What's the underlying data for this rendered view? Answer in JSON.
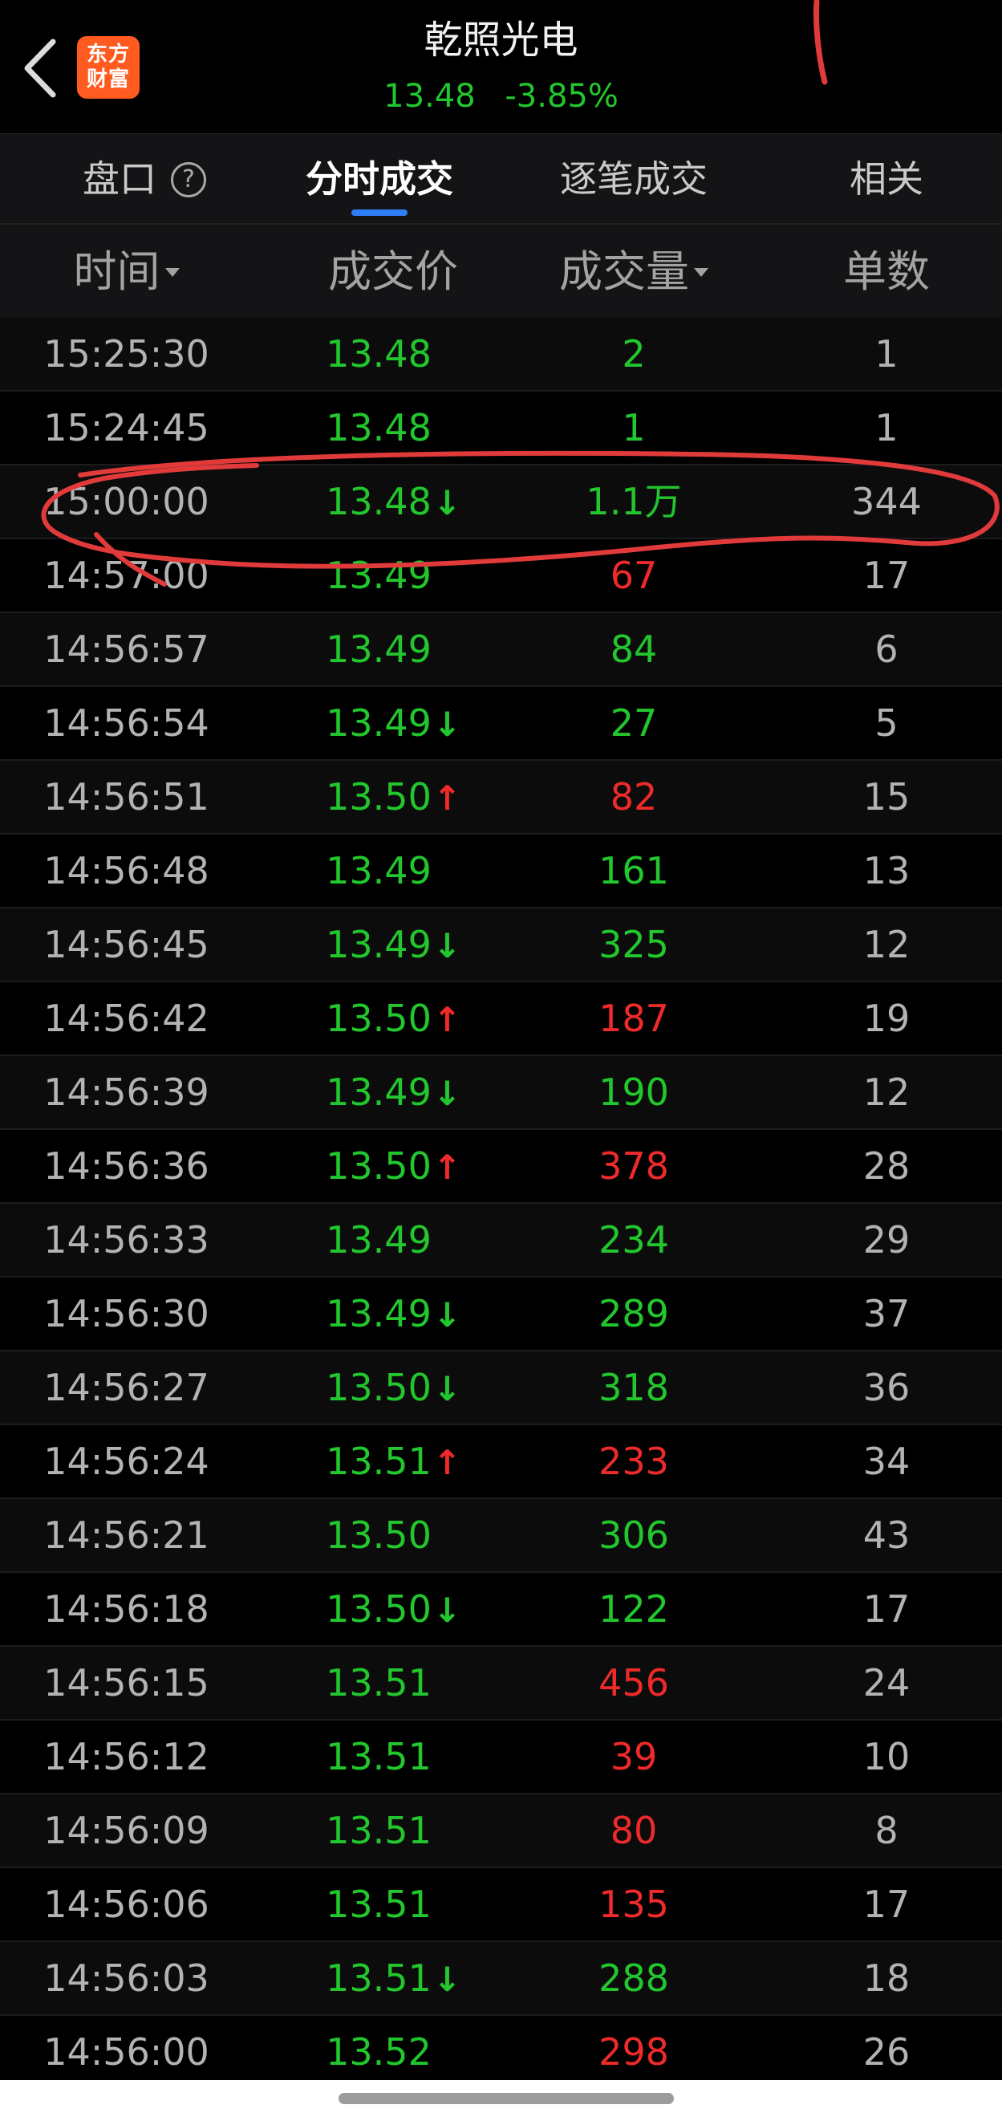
{
  "header": {
    "stock_name": "乾照光电",
    "price": "13.48",
    "change_pct": "-3.85%",
    "logo_line1": "东方",
    "logo_line2": "财富"
  },
  "tabs": [
    {
      "label": "盘口",
      "active": false
    },
    {
      "label": "分时成交",
      "active": true
    },
    {
      "label": "逐笔成交",
      "active": false
    },
    {
      "label": "相关",
      "active": false
    }
  ],
  "columns": {
    "time": "时间",
    "price": "成交价",
    "volume": "成交量",
    "count": "单数"
  },
  "colors": {
    "up": "#ee2a2a",
    "down": "#22c72e",
    "annotation": "#e03a3a"
  },
  "trades": [
    {
      "time": "15:25:30",
      "price": "13.48",
      "arrow": "",
      "volume": "2",
      "vol_color": "green",
      "count": "1"
    },
    {
      "time": "15:24:45",
      "price": "13.48",
      "arrow": "",
      "volume": "1",
      "vol_color": "green",
      "count": "1"
    },
    {
      "time": "15:00:00",
      "price": "13.48",
      "arrow": "down",
      "volume": "1.1万",
      "vol_color": "green",
      "count": "344"
    },
    {
      "time": "14:57:00",
      "price": "13.49",
      "arrow": "",
      "volume": "67",
      "vol_color": "red",
      "count": "17"
    },
    {
      "time": "14:56:57",
      "price": "13.49",
      "arrow": "",
      "volume": "84",
      "vol_color": "green",
      "count": "6"
    },
    {
      "time": "14:56:54",
      "price": "13.49",
      "arrow": "down",
      "volume": "27",
      "vol_color": "green",
      "count": "5"
    },
    {
      "time": "14:56:51",
      "price": "13.50",
      "arrow": "up",
      "volume": "82",
      "vol_color": "red",
      "count": "15"
    },
    {
      "time": "14:56:48",
      "price": "13.49",
      "arrow": "",
      "volume": "161",
      "vol_color": "green",
      "count": "13"
    },
    {
      "time": "14:56:45",
      "price": "13.49",
      "arrow": "down",
      "volume": "325",
      "vol_color": "green",
      "count": "12"
    },
    {
      "time": "14:56:42",
      "price": "13.50",
      "arrow": "up",
      "volume": "187",
      "vol_color": "red",
      "count": "19"
    },
    {
      "time": "14:56:39",
      "price": "13.49",
      "arrow": "down",
      "volume": "190",
      "vol_color": "green",
      "count": "12"
    },
    {
      "time": "14:56:36",
      "price": "13.50",
      "arrow": "up",
      "volume": "378",
      "vol_color": "red",
      "count": "28"
    },
    {
      "time": "14:56:33",
      "price": "13.49",
      "arrow": "",
      "volume": "234",
      "vol_color": "green",
      "count": "29"
    },
    {
      "time": "14:56:30",
      "price": "13.49",
      "arrow": "down",
      "volume": "289",
      "vol_color": "green",
      "count": "37"
    },
    {
      "time": "14:56:27",
      "price": "13.50",
      "arrow": "down",
      "volume": "318",
      "vol_color": "green",
      "count": "36"
    },
    {
      "time": "14:56:24",
      "price": "13.51",
      "arrow": "up",
      "volume": "233",
      "vol_color": "red",
      "count": "34"
    },
    {
      "time": "14:56:21",
      "price": "13.50",
      "arrow": "",
      "volume": "306",
      "vol_color": "green",
      "count": "43"
    },
    {
      "time": "14:56:18",
      "price": "13.50",
      "arrow": "down",
      "volume": "122",
      "vol_color": "green",
      "count": "17"
    },
    {
      "time": "14:56:15",
      "price": "13.51",
      "arrow": "",
      "volume": "456",
      "vol_color": "red",
      "count": "24"
    },
    {
      "time": "14:56:12",
      "price": "13.51",
      "arrow": "",
      "volume": "39",
      "vol_color": "red",
      "count": "10"
    },
    {
      "time": "14:56:09",
      "price": "13.51",
      "arrow": "",
      "volume": "80",
      "vol_color": "red",
      "count": "8"
    },
    {
      "time": "14:56:06",
      "price": "13.51",
      "arrow": "",
      "volume": "135",
      "vol_color": "red",
      "count": "17"
    },
    {
      "time": "14:56:03",
      "price": "13.51",
      "arrow": "down",
      "volume": "288",
      "vol_color": "green",
      "count": "18"
    },
    {
      "time": "14:56:00",
      "price": "13.52",
      "arrow": "",
      "volume": "298",
      "vol_color": "red",
      "count": "26"
    }
  ]
}
